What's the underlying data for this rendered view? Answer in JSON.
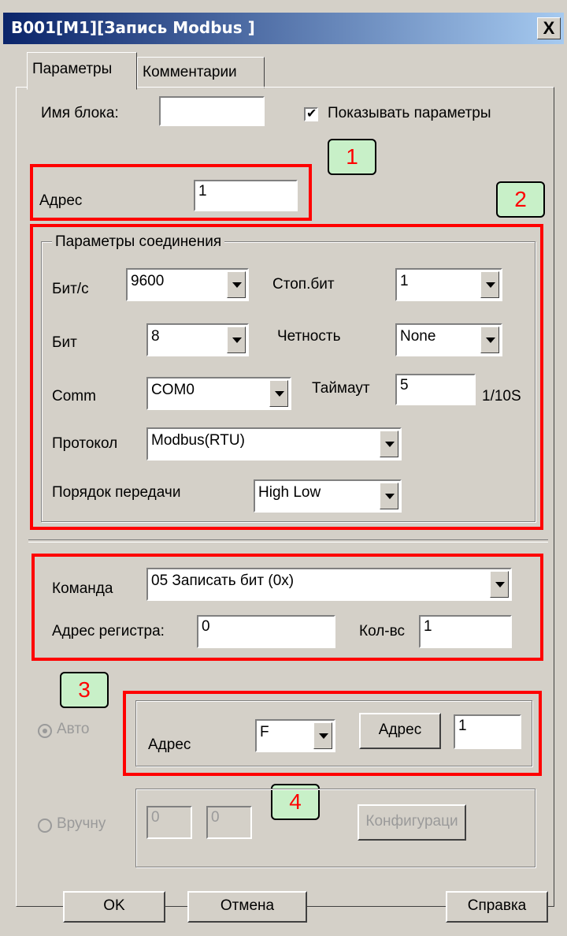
{
  "window": {
    "title": "B001[M1][Запись Modbus ]",
    "close": "X"
  },
  "tabs": [
    {
      "label": "Параметры",
      "active": true
    },
    {
      "label": "Комментарии",
      "active": false
    }
  ],
  "block": {
    "name_label": "Имя блока:",
    "name_value": "",
    "show_params_label": "Показывать параметры",
    "show_params_checked": true
  },
  "address": {
    "label": "Адрес",
    "value": "1"
  },
  "connection": {
    "legend": "Параметры соединения",
    "baud_label": "Бит/с",
    "baud_value": "9600",
    "stop_label": "Стоп.бит",
    "stop_value": "1",
    "bits_label": "Бит",
    "bits_value": "8",
    "parity_label": "Четность",
    "parity_value": "None",
    "comm_label": "Comm",
    "comm_value": "COM0",
    "timeout_label": "Таймаут",
    "timeout_value": "5",
    "timeout_unit": "1/10S",
    "protocol_label": "Протокол",
    "protocol_value": "Modbus(RTU)",
    "order_label": "Порядок передачи",
    "order_value": "High Low"
  },
  "command": {
    "label": "Команда",
    "value": "05 Записать бит (0x)",
    "reg_label": "Адрес регистра:",
    "reg_value": "0",
    "count_label": "Кол-вс",
    "count_value": "1"
  },
  "auto": {
    "label": "Авто",
    "selected": true,
    "addr_label": "Адрес",
    "addr_type": "F",
    "addr_button": "Адрес",
    "addr_value": "1"
  },
  "manual": {
    "label": "Вручну",
    "selected": false,
    "value1": "0",
    "value2": "0",
    "config_button": "Конфигураци"
  },
  "callouts": [
    "1",
    "2",
    "3",
    "4"
  ],
  "buttons": {
    "ok": "OK",
    "cancel": "Отмена",
    "help": "Справка"
  },
  "colors": {
    "highlight": "#ff0000",
    "callout_bg": "#c8f0c8",
    "title_bar": "#0a246a"
  }
}
